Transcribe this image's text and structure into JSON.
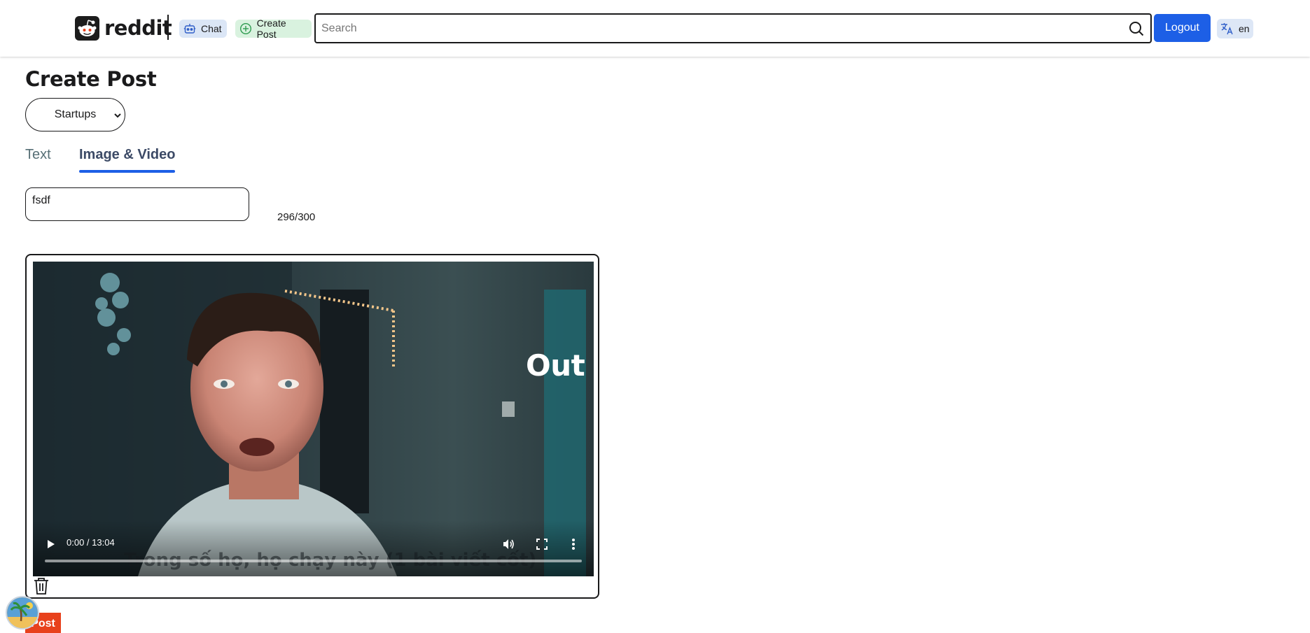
{
  "header": {
    "logo_text": "reddit",
    "chat_label": "Chat",
    "create_post_label": "Create Post",
    "search_placeholder": "Search",
    "logout_label": "Logout",
    "language": "en"
  },
  "page": {
    "title": "Create Post",
    "community_selected": "Startups",
    "tabs": [
      {
        "label": "Text",
        "active": false
      },
      {
        "label": "Image & Video",
        "active": true
      }
    ],
    "title_value": "fsdf",
    "char_count": "296/300"
  },
  "media": {
    "overlay_text": "Out",
    "caption_text": "Trong số họ, họ chạy này (1 bài viết cốt)",
    "time": "0:00 / 13:04",
    "progress_fraction": 0
  },
  "post_button_label": "Post",
  "colors": {
    "accent_blue": "#1d5fe6",
    "post_orange": "#e8411c",
    "chat_pill_bg": "#dbe6f6",
    "create_pill_bg": "#d9f2df"
  }
}
